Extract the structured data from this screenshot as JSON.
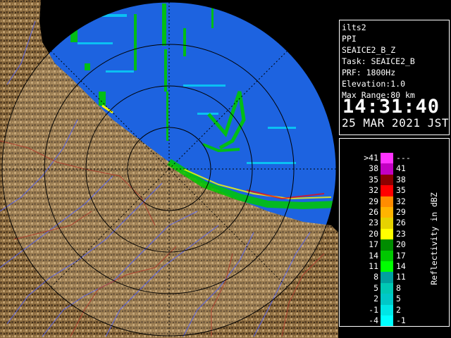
{
  "info": {
    "radar": "ilts2",
    "product": "PPI",
    "product_name": "SEAICE2_B_Z",
    "task": "Task: SEAICE2_B",
    "prf": "PRF: 1800Hz",
    "elevation": "Elevation:1.0",
    "max_range": "Max Range:80 km",
    "time": "14:31:40",
    "date": "25 MAR 2021 JST"
  },
  "legend": {
    "title": "Reflectivity in dBZ",
    "rows": [
      {
        "lo": ">41",
        "hi": "---",
        "color": "#ff33ff"
      },
      {
        "lo": "38",
        "hi": "41",
        "color": "#c200c2"
      },
      {
        "lo": "35",
        "hi": "38",
        "color": "#8c0000"
      },
      {
        "lo": "32",
        "hi": "35",
        "color": "#ff0000"
      },
      {
        "lo": "29",
        "hi": "32",
        "color": "#ff8c00"
      },
      {
        "lo": "26",
        "hi": "29",
        "color": "#ffb400"
      },
      {
        "lo": "23",
        "hi": "26",
        "color": "#e6d200"
      },
      {
        "lo": "20",
        "hi": "23",
        "color": "#ffff00"
      },
      {
        "lo": "17",
        "hi": "20",
        "color": "#008c00"
      },
      {
        "lo": "14",
        "hi": "17",
        "color": "#00c800"
      },
      {
        "lo": "11",
        "hi": "14",
        "color": "#00ff00"
      },
      {
        "lo": "8",
        "hi": "11",
        "color": "#00a0a0"
      },
      {
        "lo": "5",
        "hi": "8",
        "color": "#00c8b4"
      },
      {
        "lo": "2",
        "hi": "5",
        "color": "#00c8c8"
      },
      {
        "lo": "-1",
        "hi": "2",
        "color": "#00e6e6"
      },
      {
        "lo": "-4",
        "hi": "-1",
        "color": "#00ffff"
      }
    ]
  },
  "map": {
    "colors": {
      "sea_outside": "#000000",
      "radar_background": "#1d63e0",
      "land": "#8a6a3e",
      "land_dark": "#4a3520",
      "land_light": "#c8ae82",
      "river": "#5060ff",
      "border": "#b03a2a",
      "range_ring": "#000000"
    },
    "range_rings_km": [
      20,
      40,
      60,
      80
    ]
  }
}
